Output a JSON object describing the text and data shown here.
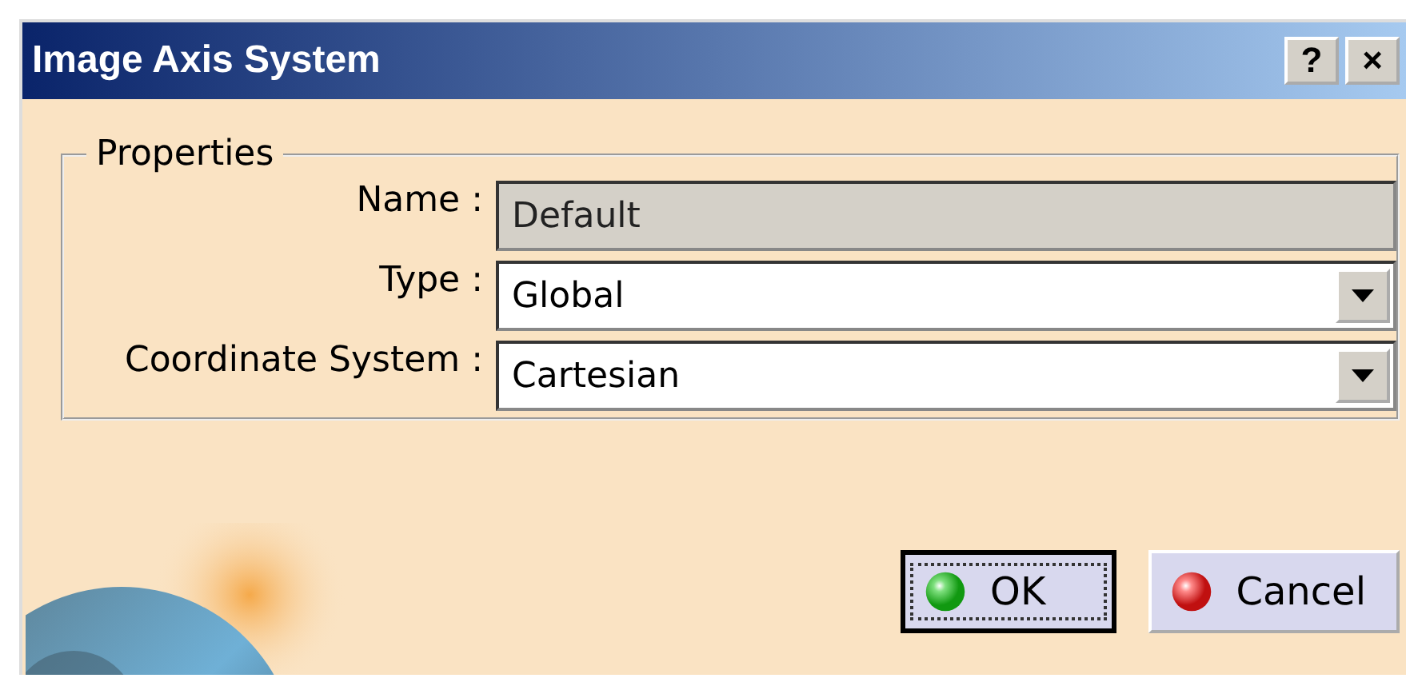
{
  "window": {
    "title": "Image Axis System",
    "title_buttons": [
      "?",
      "×"
    ]
  },
  "properties": {
    "legend": "Properties",
    "fields": [
      {
        "label": "Name :",
        "value": "Default",
        "kind": "text",
        "disabled": true
      },
      {
        "label": "Type :",
        "value": "Global",
        "kind": "dropdown",
        "disabled": false
      },
      {
        "label": "Coordinate System :",
        "value": "Cartesian",
        "kind": "dropdown",
        "disabled": false
      }
    ]
  },
  "buttons": [
    {
      "label": "OK",
      "kind": "ok",
      "default": true
    },
    {
      "label": "Cancel",
      "kind": "cancel",
      "default": false
    }
  ]
}
